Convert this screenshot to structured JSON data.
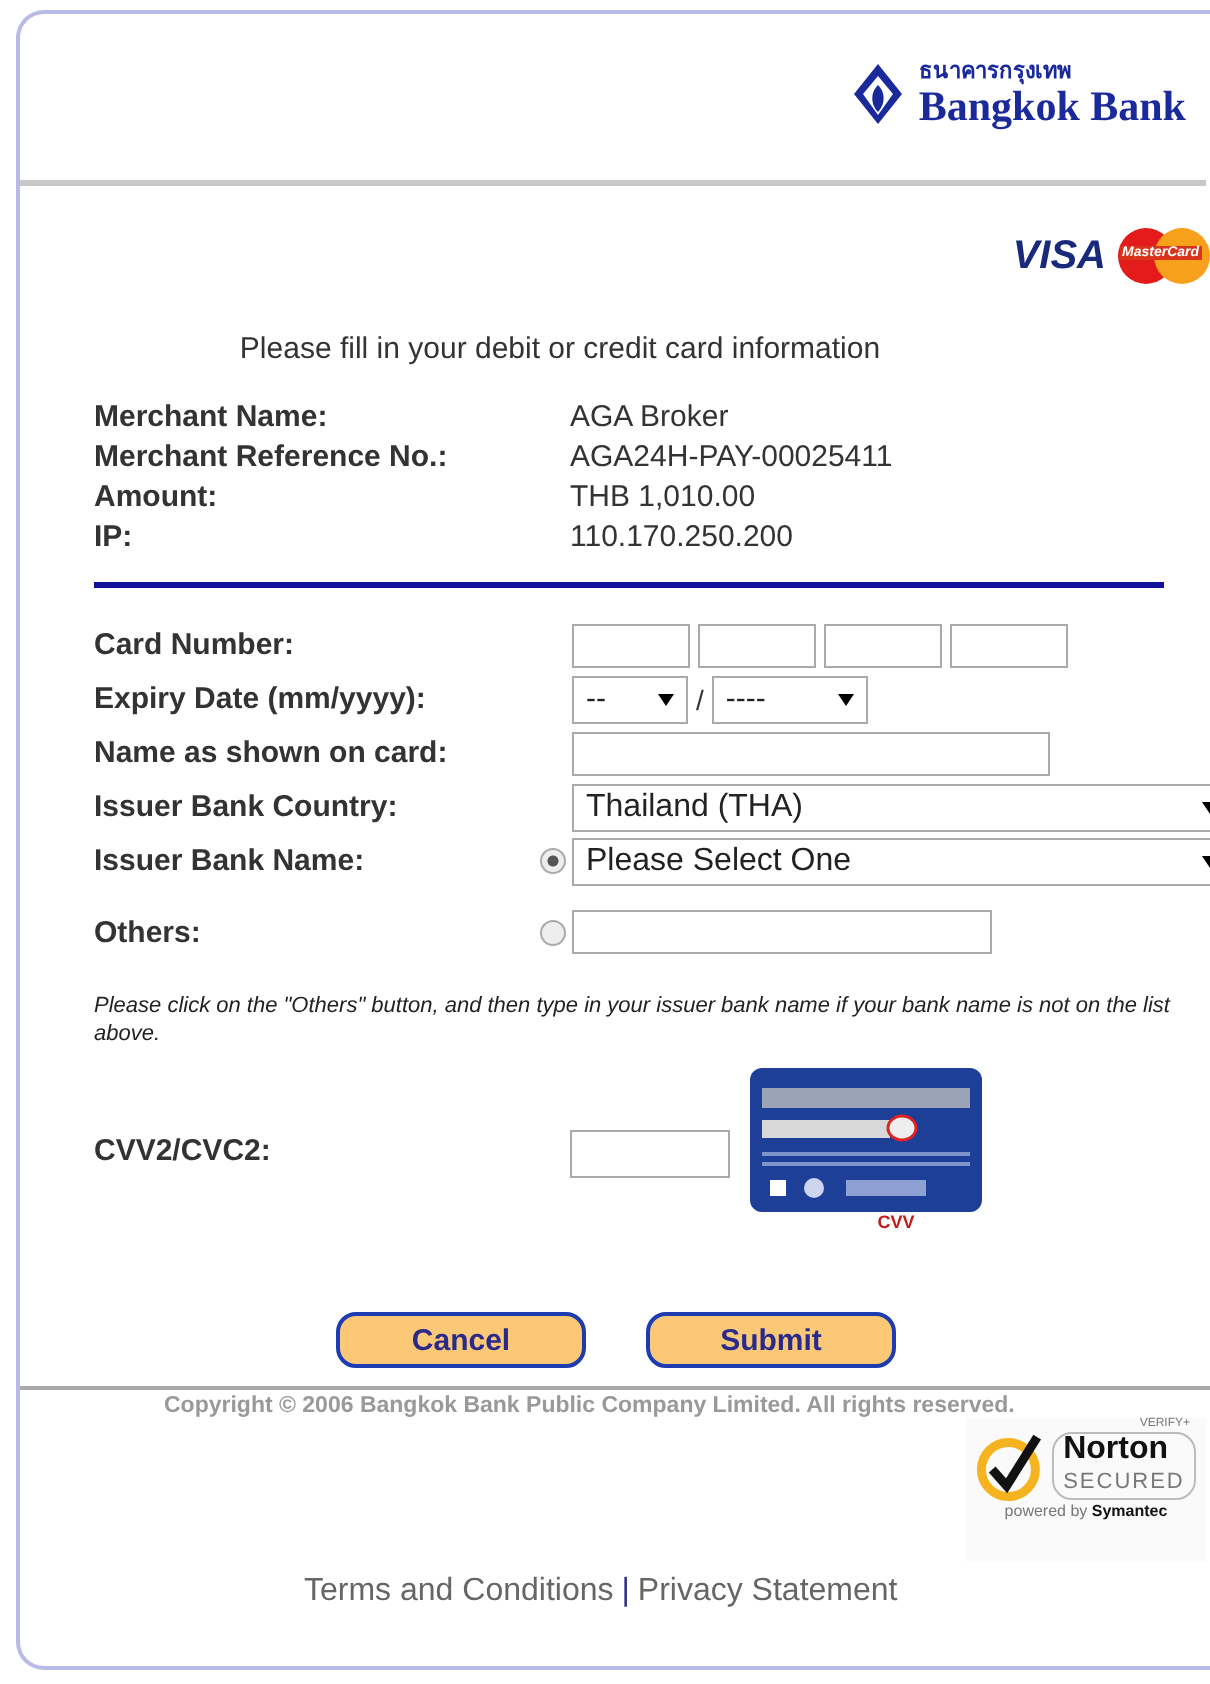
{
  "logo": {
    "thai_name": "ธนาคารกรุงเทพ",
    "name": "Bangkok Bank"
  },
  "card_brands": {
    "visa": "VISA",
    "mastercard": "MasterCard"
  },
  "instruction": "Please fill in your debit or credit card information",
  "merchant_info": [
    {
      "label": "Merchant Name:",
      "value": "AGA Broker"
    },
    {
      "label": "Merchant Reference No.:",
      "value": "AGA24H-PAY-00025411"
    },
    {
      "label": "Amount:",
      "value": "THB 1,010.00"
    },
    {
      "label": "IP:",
      "value": "110.170.250.200"
    }
  ],
  "form_rows": [
    {
      "kind": "card_number",
      "label": "Card Number:"
    },
    {
      "kind": "expiry",
      "label": "Expiry Date (mm/yyyy):",
      "month": "--",
      "separator": "/",
      "year": "----"
    },
    {
      "kind": "text",
      "label": "Name as shown on card:"
    },
    {
      "kind": "select",
      "label": "Issuer Bank Country:",
      "value": "Thailand (THA)"
    },
    {
      "kind": "radio_select",
      "label": "Issuer Bank Name:",
      "value": "Please Select One",
      "selected": true
    },
    {
      "kind": "radio_text",
      "label": "Others:",
      "selected": false
    }
  ],
  "note": "Please click on the \"Others\" button, and then type in your issuer bank name if your bank name is not on the list above.",
  "cvv": {
    "label": "CVV2/CVC2:",
    "image_caption": "CVV"
  },
  "buttons": [
    "Cancel",
    "Submit"
  ],
  "copyright": "Copyright © 2006 Bangkok Bank Public Company Limited. All rights reserved.",
  "norton": {
    "verify": "VERIFY+",
    "name": "Norton",
    "secured": "SECURED",
    "powered_by": "powered by",
    "company": "Symantec"
  },
  "footer_links": [
    "Terms and Conditions",
    "Privacy Statement"
  ],
  "footer_separator": "|"
}
